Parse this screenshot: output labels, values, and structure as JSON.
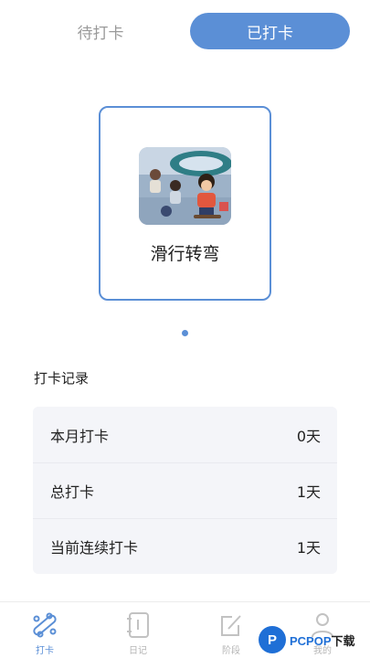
{
  "tabs": {
    "pending_label": "待打卡",
    "done_label": "已打卡",
    "active": "已打卡"
  },
  "card": {
    "title": "滑行转弯",
    "image": "skateboarding-kids-illustration"
  },
  "carousel": {
    "pages": 1,
    "current": 1
  },
  "records": {
    "title": "打卡记录",
    "rows": [
      {
        "label": "本月打卡",
        "value": "0天"
      },
      {
        "label": "总打卡",
        "value": "1天"
      },
      {
        "label": "当前连续打卡",
        "value": "1天"
      }
    ]
  },
  "nav": {
    "items": [
      {
        "label": "打卡",
        "icon": "skateboard-icon",
        "active": true
      },
      {
        "label": "日记",
        "icon": "diary-icon",
        "active": false
      },
      {
        "label": "阶段",
        "icon": "edit-icon",
        "active": false
      },
      {
        "label": "我的",
        "icon": "profile-icon",
        "active": false
      }
    ]
  },
  "watermark": {
    "logo": "P",
    "brand": "PCPOP",
    "suffix": "下载"
  },
  "colors": {
    "accent": "#5b8fd6",
    "record_bg": "#f4f5f9",
    "inactive": "#b5b5b5"
  }
}
